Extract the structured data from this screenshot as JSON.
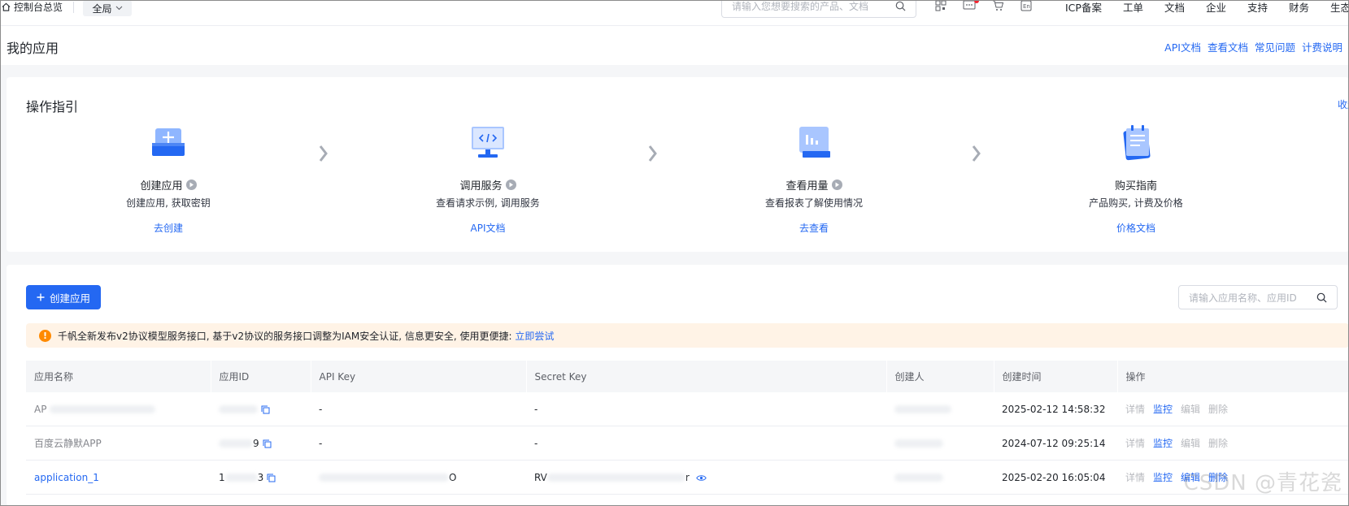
{
  "topnav": {
    "home_label": "控制台总览",
    "region_label": "全局",
    "search_placeholder": "请输入您想要搜索的产品、文档",
    "links": [
      "ICP备案",
      "工单",
      "文档",
      "企业",
      "支持",
      "财务",
      "生态"
    ]
  },
  "page": {
    "title": "我的应用",
    "header_links": [
      "API文档",
      "查看文档",
      "常见问题",
      "计费说明"
    ]
  },
  "guide": {
    "title": "操作指引",
    "collapse_label": "收起",
    "steps": [
      {
        "name": "创建应用",
        "desc": "创建应用, 获取密钥",
        "action": "去创建"
      },
      {
        "name": "调用服务",
        "desc": "查看请求示例, 调用服务",
        "action": "API文档"
      },
      {
        "name": "查看用量",
        "desc": "查看报表了解使用情况",
        "action": "去查看"
      },
      {
        "name": "购买指南",
        "desc": "产品购买, 计费及价格",
        "action": "价格文档"
      }
    ]
  },
  "apps": {
    "create_label": "创建应用",
    "search_placeholder": "请输入应用名称、应用ID",
    "notice_text": "千帆全新发布v2协议模型服务接口, 基于v2协议的服务接口调整为IAM安全认证, 信息更安全, 使用更便捷: ",
    "notice_link": "立即尝试",
    "columns": [
      "应用名称",
      "应用ID",
      "API Key",
      "Secret Key",
      "创建人",
      "创建时间",
      "操作"
    ],
    "rows": [
      {
        "name": "AP",
        "app_id": "",
        "api_key": "-",
        "secret_key": "-",
        "creator": "",
        "created": "2025-02-12 14:58:32"
      },
      {
        "name": "百度云静默APP",
        "app_id": "9",
        "api_key": "-",
        "secret_key": "-",
        "creator": "",
        "created": "2024-07-12 09:25:14"
      },
      {
        "name": "application_1",
        "app_id": "1",
        "app_id_tail": "3",
        "api_key": "O",
        "secret_key": "RV",
        "secret_tail": "r",
        "creator": "",
        "created": "2025-02-20 16:05:04"
      }
    ],
    "ops": [
      "详情",
      "监控",
      "编辑",
      "删除"
    ]
  },
  "watermark": "CSDN @青花瓷"
}
